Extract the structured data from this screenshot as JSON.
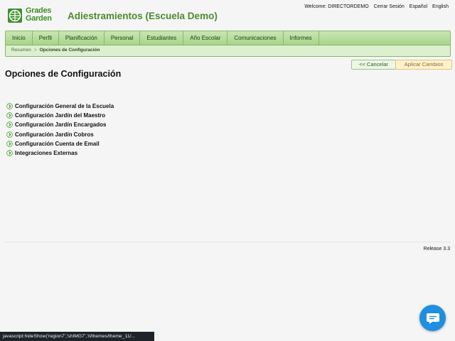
{
  "header": {
    "logo_line1": "Grades",
    "logo_line2": "Garden",
    "app_title": "Adiestramientos (Escuela Demo)",
    "welcome": "Welcome: DIRECTORDEMO",
    "logout": "Cerrar Sesión",
    "lang_es": "Español",
    "lang_en": "English"
  },
  "nav": {
    "tabs": [
      "Inicio",
      "Perfil",
      "Planificación",
      "Personal",
      "Estudiantes",
      "Año Escolar",
      "Comunicaciones",
      "Informes"
    ],
    "breadcrumb": {
      "home": "Resumen",
      "separator": ">",
      "current": "Opciones de Configuración"
    }
  },
  "actions": {
    "cancel": "<< Cancelar",
    "apply": "Aplicar Cambios"
  },
  "page": {
    "title": "Opciones de Configuración",
    "options": [
      "Configuración General de la Escuela",
      "Configuración Jardín del Maestro",
      "Configuración Jardín Encargados",
      "Configuración Jardín Cobros",
      "Configuración Cuenta de Email",
      "Integraciones Externas"
    ]
  },
  "footer": {
    "release": "Release 3.3"
  },
  "status_bar": {
    "text": "javascript:hideShow('region7','shIMG7','/i/themes/theme_11/..."
  },
  "colors": {
    "brand_green": "#3d8f2a",
    "nav_bg": "#dcefcf",
    "chat_blue": "#1f8fe0"
  },
  "icons": {
    "logo": "grades-garden-logo-icon",
    "option_bullet": "arrow-circle-icon",
    "chat": "chat-bubble-icon"
  }
}
